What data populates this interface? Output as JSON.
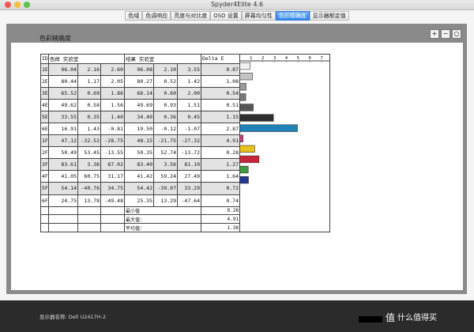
{
  "window": {
    "title": "Spyder4Elite 4.6"
  },
  "tabs": [
    {
      "label": "色域",
      "active": false
    },
    {
      "label": "色调响应",
      "active": false
    },
    {
      "label": "亮度与对比度",
      "active": false
    },
    {
      "label": "OSD 设置",
      "active": false
    },
    {
      "label": "屏幕均匀性",
      "active": false
    },
    {
      "label": "色彩精确度",
      "active": true
    },
    {
      "label": "显示器额定值",
      "active": false
    }
  ],
  "zoom": {
    "zoom_in": "+",
    "zoom_out": "−",
    "zoom_fit": "○"
  },
  "report": {
    "title": "色彩精确度",
    "headers": {
      "id": "ID",
      "sample": "色样 实验室",
      "result": "结果 实验室",
      "delta": "Delta E"
    },
    "rows": [
      {
        "id": "1E",
        "s": [
          "96.04",
          "2.16",
          "2.60"
        ],
        "r": [
          "96.08",
          "2.10",
          "3.55"
        ],
        "d": "0.87"
      },
      {
        "id": "2E",
        "s": [
          "80.44",
          "1.17",
          "2.05"
        ],
        "r": [
          "80.27",
          "0.52",
          "1.42"
        ],
        "d": "1.08"
      },
      {
        "id": "3E",
        "s": [
          "65.52",
          "0.69",
          "1.86"
        ],
        "r": [
          "66.14",
          "0.60",
          "2.00"
        ],
        "d": "0.54"
      },
      {
        "id": "4E",
        "s": [
          "49.62",
          "0.58",
          "1.56"
        ],
        "r": [
          "49.69",
          "0.93",
          "1.51"
        ],
        "d": "0.51"
      },
      {
        "id": "5E",
        "s": [
          "33.55",
          "0.35",
          "1.40"
        ],
        "r": [
          "34.40",
          "0.36",
          "0.45"
        ],
        "d": "1.15"
      },
      {
        "id": "6E",
        "s": [
          "16.91",
          "1.43",
          "-0.81"
        ],
        "r": [
          "19.50",
          "-0.12",
          "-1.07"
        ],
        "d": "2.87"
      },
      {
        "id": "1F",
        "s": [
          "47.12",
          "-32.52",
          "-28.75"
        ],
        "r": [
          "48.15",
          "-21.75",
          "-27.32"
        ],
        "d": "4.91"
      },
      {
        "id": "2F",
        "s": [
          "50.49",
          "53.45",
          "-13.55"
        ],
        "r": [
          "50.35",
          "52.74",
          "-13.72"
        ],
        "d": "0.28"
      },
      {
        "id": "3F",
        "s": [
          "83.61",
          "3.36",
          "87.02"
        ],
        "r": [
          "83.40",
          "3.56",
          "81.10"
        ],
        "d": "1.27"
      },
      {
        "id": "4F",
        "s": [
          "41.05",
          "60.75",
          "31.17"
        ],
        "r": [
          "41.42",
          "59.24",
          "27.49"
        ],
        "d": "1.64"
      },
      {
        "id": "5F",
        "s": [
          "54.14",
          "-40.76",
          "34.75"
        ],
        "r": [
          "54.42",
          "-39.07",
          "33.29"
        ],
        "d": "0.72"
      },
      {
        "id": "6F",
        "s": [
          "24.75",
          "13.78",
          "-49.48"
        ],
        "r": [
          "25.35",
          "13.29",
          "-47.64"
        ],
        "d": "0.74"
      }
    ],
    "summary": [
      {
        "label": "最小值",
        "value": "0.28"
      },
      {
        "label": "最大值：",
        "value": "4.91"
      },
      {
        "label": "平均值：",
        "value": "1.38"
      }
    ]
  },
  "chart_data": {
    "type": "bar",
    "orientation": "horizontal",
    "categories": [
      "1E",
      "2E",
      "3E",
      "4E",
      "5E",
      "6E",
      "1F",
      "2F",
      "3F",
      "4F",
      "5F",
      "6F"
    ],
    "values": [
      0.87,
      1.08,
      0.54,
      0.51,
      1.15,
      2.87,
      4.91,
      0.28,
      1.27,
      1.64,
      0.72,
      0.74
    ],
    "colors": [
      "#f2f2f2",
      "#c4c4c4",
      "#9b9b9b",
      "#7a7a7a",
      "#555555",
      "#2e2e2e",
      "#1f82b8",
      "#c8407f",
      "#e8c21c",
      "#c7243a",
      "#3d9a3d",
      "#25388f"
    ],
    "xticks": [
      "1",
      "2",
      "3",
      "4",
      "5",
      "6",
      "7"
    ],
    "xlim": [
      0,
      7.6
    ]
  },
  "footer": {
    "display_name": "显示器名称: Dell U2417H-2",
    "watermark": "值 什么值得买"
  }
}
